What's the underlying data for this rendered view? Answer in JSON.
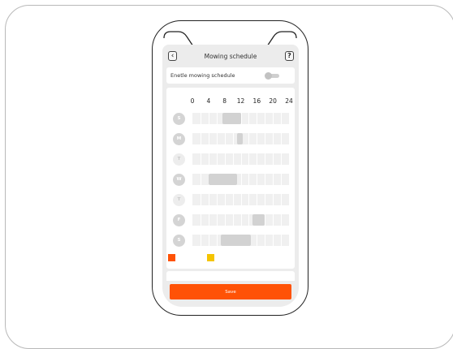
{
  "nav": {
    "back_icon": "chevron-left-icon",
    "back_glyph": "‹",
    "title": "Mowing schedule",
    "help_icon": "question-mark-icon",
    "help_glyph": "?"
  },
  "enable_schedule": {
    "label": "Enetle mowing schedule",
    "toggle_state": "off"
  },
  "schedule": {
    "hour_labels": [
      "0",
      "4",
      "8",
      "12",
      "16",
      "20",
      "24"
    ],
    "days": [
      {
        "letter": "S",
        "active": true,
        "blocks": [
          [
            7.5,
            12
          ]
        ]
      },
      {
        "letter": "M",
        "active": true,
        "blocks": [
          [
            11,
            12.5
          ]
        ]
      },
      {
        "letter": "T",
        "active": false,
        "blocks": []
      },
      {
        "letter": "W",
        "active": true,
        "blocks": [
          [
            4,
            11
          ]
        ]
      },
      {
        "letter": "T",
        "active": false,
        "blocks": []
      },
      {
        "letter": "F",
        "active": true,
        "blocks": [
          [
            15,
            18
          ]
        ]
      },
      {
        "letter": "S",
        "active": true,
        "blocks": [
          [
            7,
            14.5
          ]
        ]
      }
    ]
  },
  "legend": {
    "swatches": [
      {
        "name": "orange-swatch",
        "color": "#ff5206"
      },
      {
        "name": "yellow-swatch",
        "color": "#f5c400"
      }
    ]
  },
  "footer": {
    "save_label": "Save"
  },
  "colors": {
    "accent": "#ff5206",
    "block": "#d2d2d2",
    "track": "#f0f0f0"
  }
}
